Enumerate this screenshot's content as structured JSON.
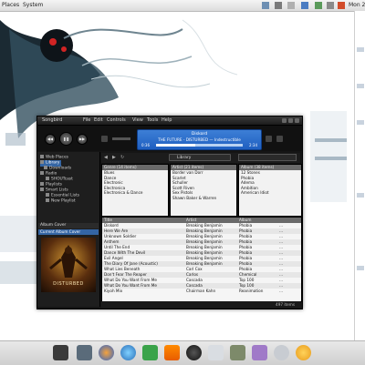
{
  "top_panel": {
    "menus": [
      "Places",
      "System"
    ],
    "clock": "Mon 2"
  },
  "window": {
    "app_name": "Songbird",
    "menu": [
      "File",
      "Edit",
      "Controls",
      "View",
      "Tools",
      "Help"
    ]
  },
  "now_playing": {
    "title": "Diskord",
    "subtitle": "THE FUTURE - DISTURBED — Indestructible",
    "elapsed": "0:36",
    "total": "2:34",
    "progress": 0.45
  },
  "sidebar": {
    "items": [
      {
        "label": "Web Places"
      },
      {
        "label": "Library"
      },
      {
        "label": "Downloads"
      },
      {
        "label": "Radio"
      },
      {
        "label": "SHOUTcast"
      },
      {
        "label": "Playlists"
      },
      {
        "label": "Smart Lists"
      },
      {
        "label": "Essential Lists"
      },
      {
        "label": "New Playlist"
      }
    ],
    "album_header": "Album Cover",
    "album_sub": "Current Album Cover",
    "cover_text": "DISTURBED"
  },
  "filter": {
    "library_label": "Library"
  },
  "panes": [
    {
      "header": "Genre (14 items)",
      "rows": [
        "Blues",
        "Dance",
        "Electronic",
        "Electronica",
        "Electronica & Dance"
      ]
    },
    {
      "header": "Artist (21 items)",
      "rows": [
        "Breaking Benjamin",
        "Border van Dorr",
        "Scarlet",
        "Schuller",
        "Scott Riven",
        "Sex Pistols",
        "Shawn Baker & Warren"
      ]
    },
    {
      "header": "Album (38 items)",
      "rows": [
        "12 Stones",
        "Phobia",
        "Adema",
        "Ambition",
        "American Idiot"
      ]
    }
  ],
  "tracks": {
    "columns": [
      "Title",
      "Artist",
      "Album",
      ""
    ],
    "rows": [
      [
        "Diskord",
        "Breaking Benjamin",
        "Phobia",
        "..."
      ],
      [
        "Here We Are",
        "Breaking Benjamin",
        "Phobia",
        "..."
      ],
      [
        "Unknown Soldier",
        "Breaking Benjamin",
        "Phobia",
        "..."
      ],
      [
        "Anthem",
        "Breaking Benjamin",
        "Phobia",
        "..."
      ],
      [
        "Until The End",
        "Breaking Benjamin",
        "Phobia",
        "..."
      ],
      [
        "Dance With The Devil",
        "Breaking Benjamin",
        "Phobia",
        "..."
      ],
      [
        "Evil Angel",
        "Breaking Benjamin",
        "Phobia",
        "..."
      ],
      [
        "The Diary Of Jane (Acoustic)",
        "Breaking Benjamin",
        "Phobia",
        "..."
      ],
      [
        "What Lies Beneath",
        "Carl Cox",
        "Phobia",
        "..."
      ],
      [
        "Don't Fear The Reaper",
        "Carlos",
        "Chemical",
        "..."
      ],
      [
        "What Do You Want From Me",
        "Cascada",
        "Top 100",
        "..."
      ],
      [
        "What Do You Want From Me",
        "Cascada",
        "Top 100",
        "..."
      ],
      [
        "Kiyoh Mix",
        "Chairman Kahn",
        "Reanimation",
        "..."
      ]
    ]
  },
  "status": {
    "text": "497 items"
  }
}
